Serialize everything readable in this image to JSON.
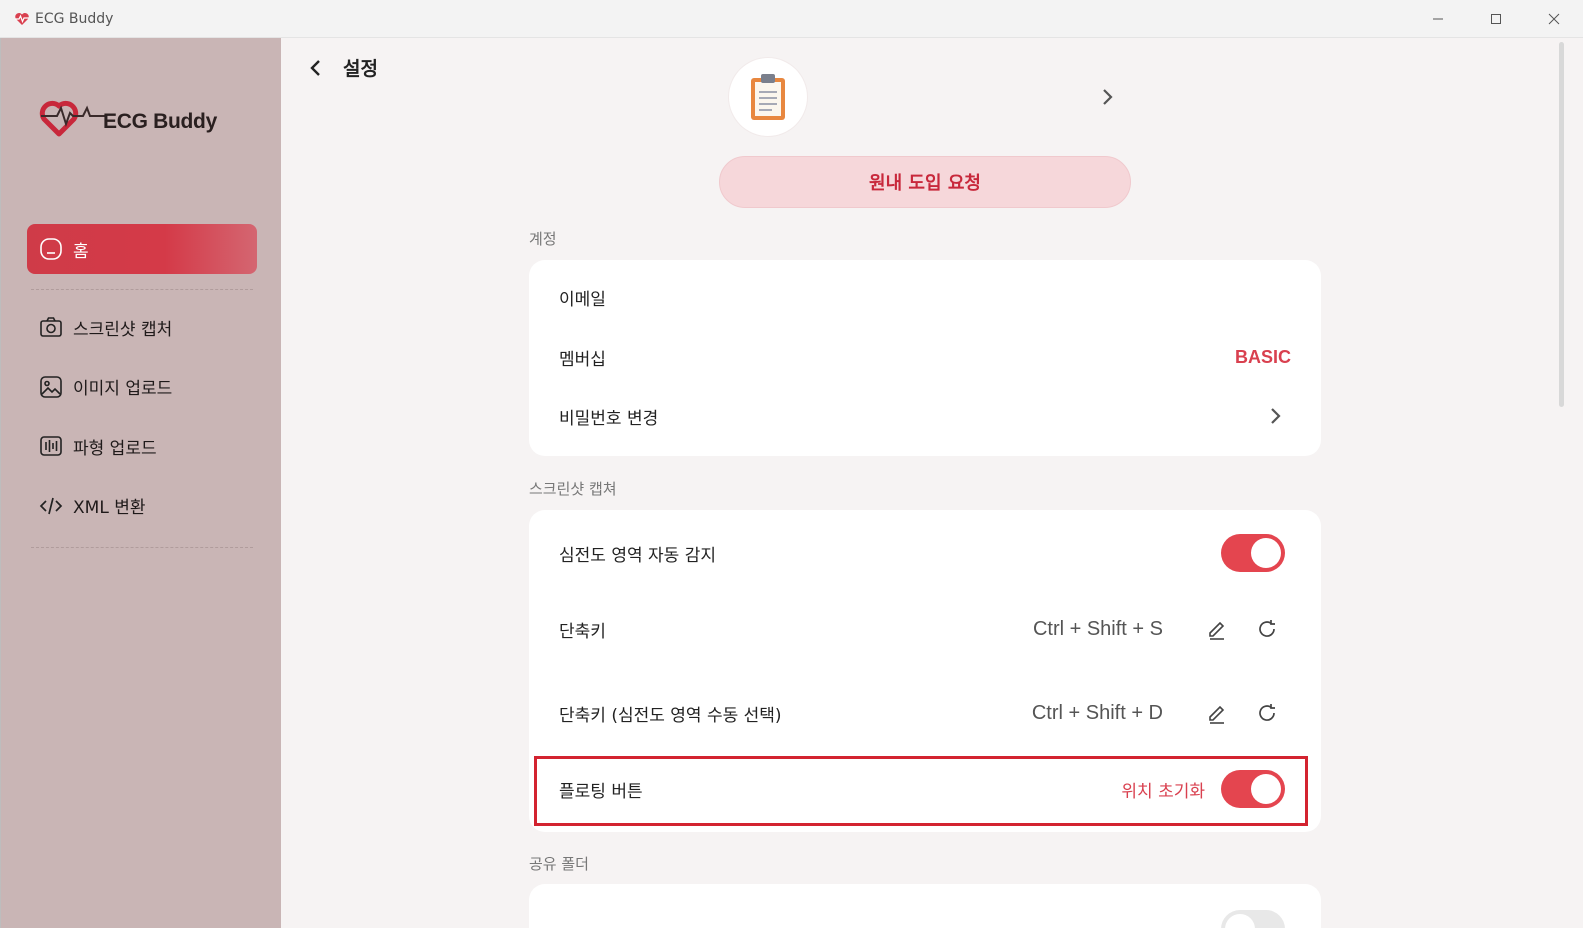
{
  "window": {
    "title": "ECG Buddy"
  },
  "sidebar": {
    "logo_text": "ECG Buddy",
    "items": [
      {
        "label": "홈",
        "icon": "home-icon",
        "active": true
      },
      {
        "label": "스크린샷 캡처",
        "icon": "camera-icon",
        "active": false
      },
      {
        "label": "이미지 업로드",
        "icon": "image-icon",
        "active": false
      },
      {
        "label": "파형 업로드",
        "icon": "waveform-icon",
        "active": false
      },
      {
        "label": "XML 변환",
        "icon": "code-icon",
        "active": false
      }
    ]
  },
  "header": {
    "title": "설정"
  },
  "profile": {
    "request_button": "원내 도입 요청"
  },
  "account": {
    "section_label": "계정",
    "email_label": "이메일",
    "email_value": "",
    "membership_label": "멤버십",
    "membership_value": "BASIC",
    "password_label": "비밀번호 변경"
  },
  "screenshot": {
    "section_label": "스크린샷 캡쳐",
    "auto_detect_label": "심전도 영역 자동 감지",
    "auto_detect_on": true,
    "shortcut_label": "단축키",
    "shortcut_value": "Ctrl + Shift + S",
    "manual_shortcut_label": "단축키 (심전도 영역 수동 선택)",
    "manual_shortcut_value": "Ctrl + Shift + D",
    "floating_label": "플로팅 버튼",
    "floating_reset": "위치 초기화",
    "floating_on": true
  },
  "shared_folder": {
    "section_label": "공유 폴더"
  },
  "colors": {
    "accent": "#e4454f",
    "sidebar_bg": "#c9b5b5",
    "active_nav": "#d43a48",
    "highlight_border": "#d32330"
  }
}
